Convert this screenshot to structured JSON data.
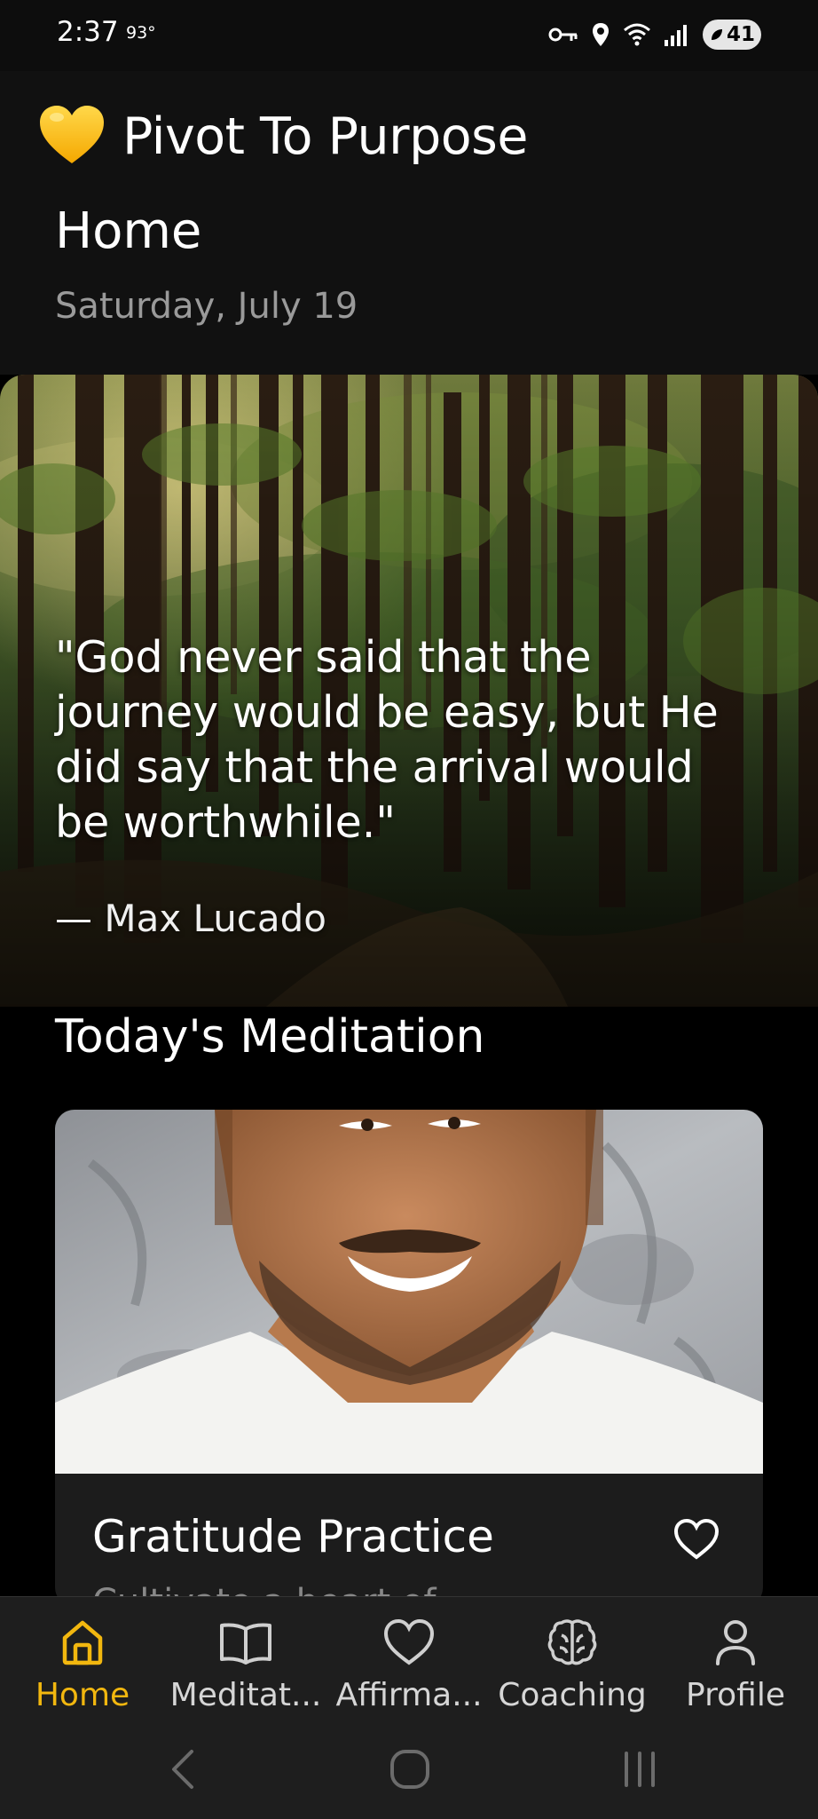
{
  "status_bar": {
    "time": "2:37",
    "temperature": "93°",
    "battery": "41",
    "icons": [
      "key-icon",
      "location-icon",
      "wifi-icon",
      "signal-icon",
      "battery-icon"
    ]
  },
  "app": {
    "name": "Pivot To Purpose",
    "logo_icon": "yellow-heart-icon"
  },
  "page": {
    "title": "Home",
    "date": "Saturday, July 19"
  },
  "quote": {
    "text": "\"God never said that the journey would be easy, but He did say that the arrival would be worthwhile.\"",
    "author": "— Max Lucado",
    "background": "forest-image"
  },
  "meditation_section": {
    "title": "Today's Meditation",
    "card": {
      "title": "Gratitude Practice",
      "subtitle": "Cultivate a heart of",
      "image": "smiling-man-portrait",
      "favorite_icon": "heart-outline-icon"
    }
  },
  "bottom_nav": {
    "items": [
      {
        "label": "Home",
        "icon": "home-icon",
        "active": true
      },
      {
        "label": "Meditat...",
        "icon": "book-icon",
        "active": false
      },
      {
        "label": "Affirma...",
        "icon": "heart-icon",
        "active": false
      },
      {
        "label": "Coaching",
        "icon": "brain-icon",
        "active": false
      },
      {
        "label": "Profile",
        "icon": "person-icon",
        "active": false
      }
    ]
  },
  "system_nav": [
    "back-icon",
    "home-circle-icon",
    "recents-icon"
  ],
  "colors": {
    "accent": "#f2b70f",
    "background": "#000000",
    "header_bg": "#111111",
    "nav_bg": "#1e1e1e"
  }
}
